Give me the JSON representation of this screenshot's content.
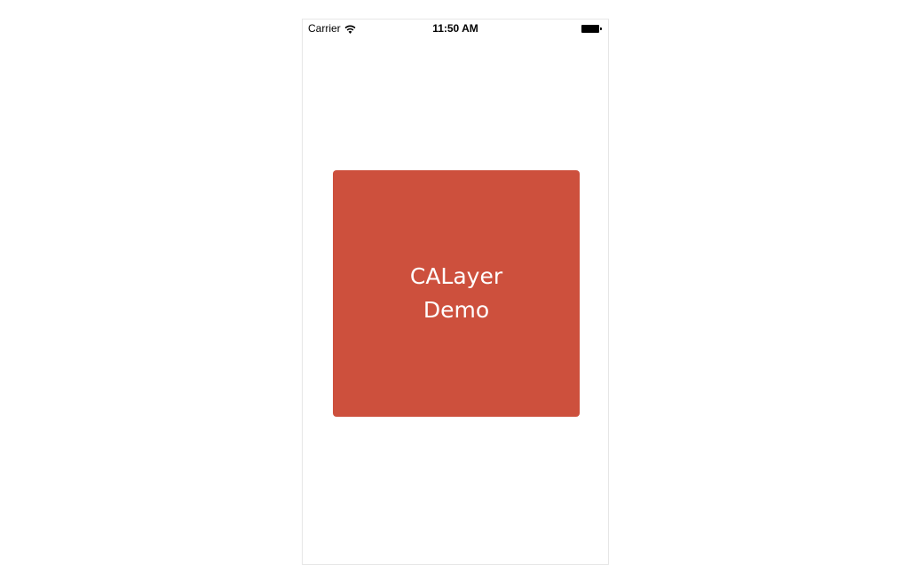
{
  "status_bar": {
    "carrier": "Carrier",
    "time": "11:50 AM",
    "wifi_icon": "wifi-icon",
    "battery_icon": "battery-icon"
  },
  "layer": {
    "title_line1": "CALayer",
    "title_line2": "Demo",
    "background_color": "#cd503d",
    "text_color": "#ffffff"
  }
}
